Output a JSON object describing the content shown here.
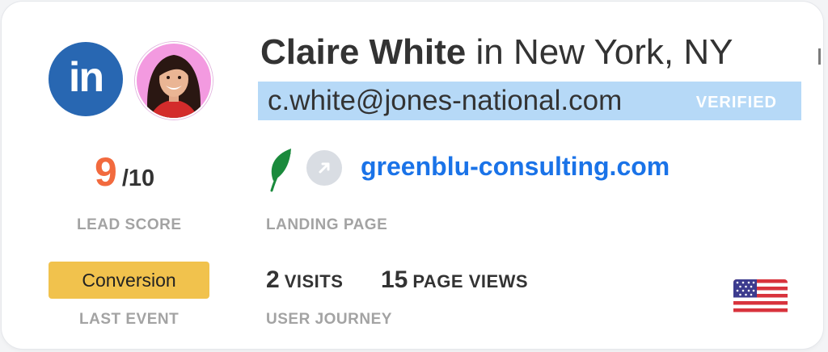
{
  "profile": {
    "name": "Claire White",
    "location_text": "in New York, NY",
    "email": "c.white@jones-national.com",
    "email_status": "VERIFIED",
    "social_icon": "linkedin-icon",
    "linkedin_glyph": "in",
    "country_flag": "us-flag-icon"
  },
  "lead_score": {
    "value": "9",
    "max": "/10",
    "label": "LEAD SCORE"
  },
  "landing_page": {
    "url": "greenblu-consulting.com",
    "label": "LANDING PAGE",
    "icons": [
      "leaf-icon",
      "external-link-icon"
    ]
  },
  "last_event": {
    "value": "Conversion",
    "label": "LAST EVENT"
  },
  "user_journey": {
    "visits_count": "2",
    "visits_label": "VISITS",
    "page_views_count": "15",
    "page_views_label": "PAGE VIEWS",
    "label": "USER JOURNEY"
  },
  "colors": {
    "linkedin_blue": "#2867b2",
    "score_orange": "#f26a3e",
    "email_highlight": "#b6d9f7",
    "link_blue": "#1a73e8",
    "event_yellow": "#f1c24d",
    "leaf_green": "#1a8a3c"
  }
}
